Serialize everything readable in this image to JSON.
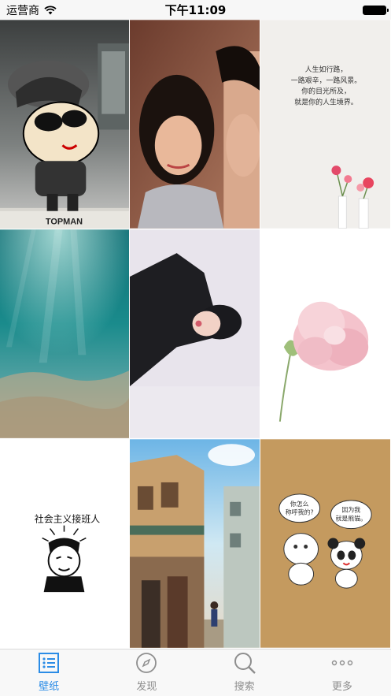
{
  "status_bar": {
    "carrier": "运营商",
    "time": "下午11:09"
  },
  "wallpapers": [
    {
      "name": "wallpaper-cartoon-topman",
      "caption": "TOPMAN"
    },
    {
      "name": "wallpaper-movie-couple"
    },
    {
      "name": "wallpaper-quote-flowers",
      "lines": [
        "人生如行路，",
        "一路艰辛，一路风景。",
        "你的目光所及，",
        "就是你的人生境界。"
      ]
    },
    {
      "name": "wallpaper-underwater"
    },
    {
      "name": "wallpaper-girl-portrait"
    },
    {
      "name": "wallpaper-pink-flower"
    },
    {
      "name": "wallpaper-socialism-successor",
      "caption": "社会主义接班人"
    },
    {
      "name": "wallpaper-anime-street"
    },
    {
      "name": "wallpaper-cartoon-panda",
      "bubble_left": [
        "你怎么",
        "称呼我的?"
      ],
      "bubble_right": [
        "因为我",
        "就是熊猫。"
      ]
    }
  ],
  "tab_bar": {
    "items": [
      {
        "label": "壁纸",
        "icon": "list-icon",
        "active": true
      },
      {
        "label": "发现",
        "icon": "compass-icon",
        "active": false
      },
      {
        "label": "搜索",
        "icon": "search-icon",
        "active": false
      },
      {
        "label": "更多",
        "icon": "more-icon",
        "active": false
      }
    ],
    "accent_color": "#2b8ce6",
    "inactive_color": "#8e8e8e"
  }
}
